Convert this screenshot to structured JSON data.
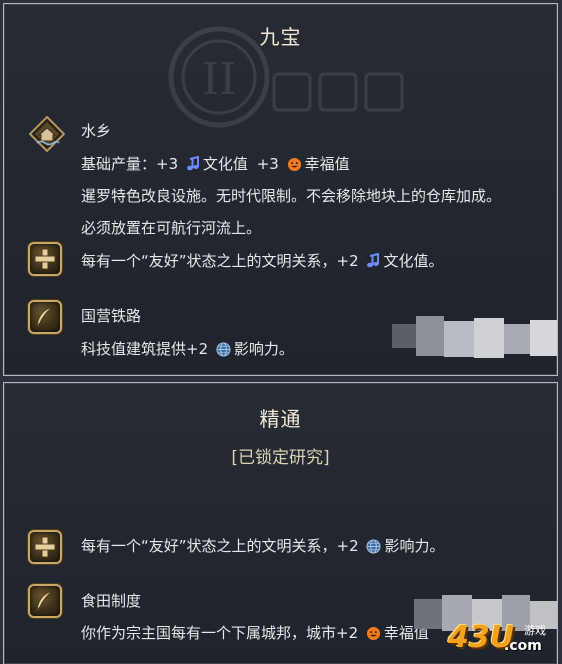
{
  "panel1": {
    "title": "九宝",
    "feature": {
      "name": "水乡",
      "yield_prefix": "基础产量：",
      "culture_amount": "+3",
      "culture_label": "文化值",
      "amenity_amount": "+3",
      "amenity_label": "幸福值",
      "desc_line1": "暹罗特色改良设施。无时代限制。不会移除地块上的仓库加成。",
      "desc_line2": "必须放置在可航行河流上。"
    },
    "ability": {
      "text_prefix": "每有一个“友好”状态之上的文明关系，",
      "amount": "+2",
      "label": "文化值。"
    },
    "policy": {
      "name": "国营铁路",
      "text_prefix": "科技值建筑提供",
      "amount": "+2",
      "label": "影响力。"
    }
  },
  "panel2": {
    "title": "精通",
    "subtitle": "[已锁定研究]",
    "ability": {
      "text_prefix": "每有一个“友好”状态之上的文明关系，",
      "amount": "+2",
      "label": "影响力。"
    },
    "policy": {
      "name": "食田制度",
      "text_prefix": "你作为宗主国每有一个下属城邦，城市",
      "amount": "+2",
      "label": "幸福值"
    }
  },
  "watermark": {
    "brand": "43U",
    "suffix": ".com",
    "tag": "游戏"
  },
  "colors": {
    "panel_bg": "#23272f",
    "border": "#b7b9be",
    "gold": "#c9a868",
    "culture": "#6b8cff",
    "amenity": "#f07a20",
    "influence": "#7aa6d6"
  },
  "icons": {
    "feature": "water-village-icon",
    "ability": "plus-cross-icon",
    "policy": "quill-icon",
    "culture": "music-note-icon",
    "amenity": "smiley-face-icon",
    "influence": "globe-icon"
  }
}
